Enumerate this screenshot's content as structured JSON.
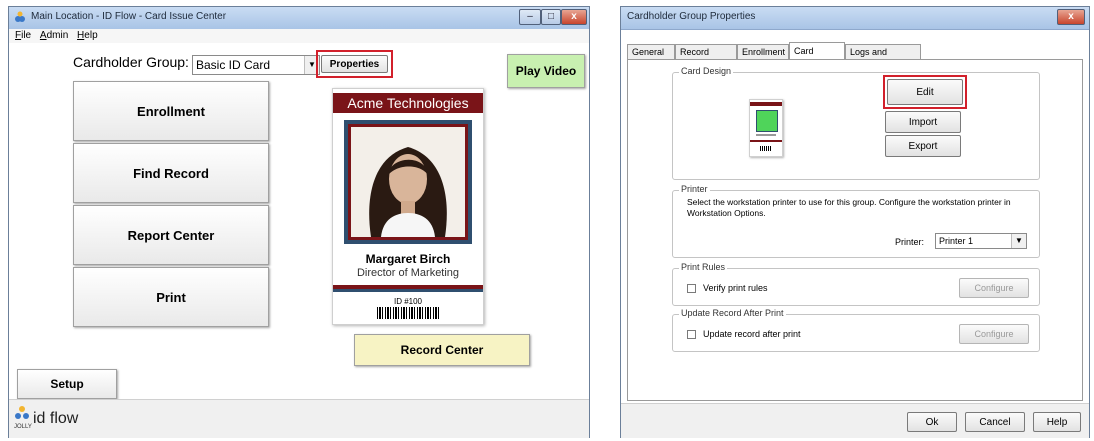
{
  "left_window": {
    "title": "Main Location - ID Flow - Card Issue Center",
    "menu": [
      "File",
      "Admin",
      "Help"
    ],
    "cardholder_group_label": "Cardholder Group:",
    "cardholder_group_value": "Basic ID Card",
    "properties_label": "Properties",
    "play_video_label": "Play Video",
    "nav_buttons": [
      "Enrollment",
      "Find Record",
      "Report Center",
      "Print"
    ],
    "record_center_label": "Record Center",
    "setup_label": "Setup",
    "footer_brand": "id flow",
    "footer_small": "JOLLY",
    "card": {
      "company": "Acme Technologies",
      "name": "Margaret Birch",
      "job_title": "Director of Marketing",
      "id_text": "ID #100",
      "header_color": "#7a1418",
      "accent_color": "#2f4f6f"
    }
  },
  "right_window": {
    "title": "Cardholder Group Properties",
    "tabs": [
      "General",
      "Record Lookup",
      "Enrollment",
      "Card Printing",
      "Logs and Reports"
    ],
    "active_tab": "Card Printing",
    "card_design": {
      "legend": "Card Design",
      "edit_label": "Edit",
      "import_label": "Import",
      "export_label": "Export"
    },
    "printer": {
      "legend": "Printer",
      "description": "Select the workstation printer to use for this group. Configure the workstation printer in Workstation Options.",
      "printer_label": "Printer:",
      "printer_value": "Printer 1"
    },
    "print_rules": {
      "legend": "Print Rules",
      "checkbox_label": "Verify print rules",
      "configure_label": "Configure"
    },
    "update_record": {
      "legend": "Update Record After Print",
      "checkbox_label": "Update record after print",
      "configure_label": "Configure"
    },
    "footer_buttons": {
      "ok": "Ok",
      "cancel": "Cancel",
      "help": "Help"
    }
  },
  "colors": {
    "highlight": "#d2202b",
    "play_video_bg": "#c8f0b0",
    "record_center_bg": "#f7f3c4"
  }
}
